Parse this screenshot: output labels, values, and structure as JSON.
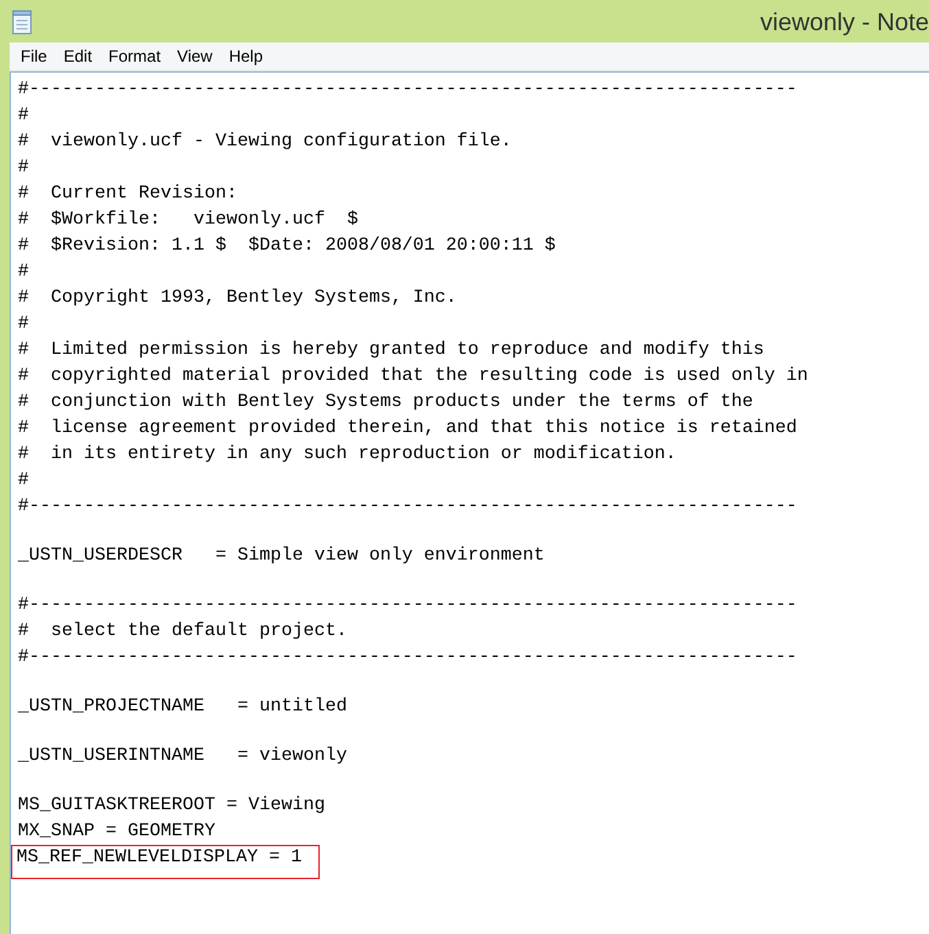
{
  "window": {
    "title": "viewonly - Note"
  },
  "menu": [
    "File",
    "Edit",
    "Format",
    "View",
    "Help"
  ],
  "lines": [
    {
      "kind": "text",
      "text": "#----------------------------------------------------------------------",
      "highlighted": false
    },
    {
      "kind": "text",
      "text": "#",
      "highlighted": false
    },
    {
      "kind": "text",
      "text": "#  viewonly.ucf - Viewing configuration file.",
      "highlighted": false
    },
    {
      "kind": "text",
      "text": "#",
      "highlighted": false
    },
    {
      "kind": "text",
      "text": "#  Current Revision:",
      "highlighted": false
    },
    {
      "kind": "text",
      "text": "#  $Workfile:   viewonly.ucf  $",
      "highlighted": false
    },
    {
      "kind": "text",
      "text": "#  $Revision: 1.1 $  $Date: 2008/08/01 20:00:11 $",
      "highlighted": false
    },
    {
      "kind": "text",
      "text": "#",
      "highlighted": false
    },
    {
      "kind": "text",
      "text": "#  Copyright 1993, Bentley Systems, Inc.",
      "highlighted": false
    },
    {
      "kind": "text",
      "text": "#",
      "highlighted": false
    },
    {
      "kind": "text",
      "text": "#  Limited permission is hereby granted to reproduce and modify this",
      "highlighted": false
    },
    {
      "kind": "text",
      "text": "#  copyrighted material provided that the resulting code is used only in",
      "highlighted": false
    },
    {
      "kind": "text",
      "text": "#  conjunction with Bentley Systems products under the terms of the",
      "highlighted": false
    },
    {
      "kind": "text",
      "text": "#  license agreement provided therein, and that this notice is retained",
      "highlighted": false
    },
    {
      "kind": "text",
      "text": "#  in its entirety in any such reproduction or modification.",
      "highlighted": false
    },
    {
      "kind": "text",
      "text": "#",
      "highlighted": false
    },
    {
      "kind": "text",
      "text": "#----------------------------------------------------------------------",
      "highlighted": false
    },
    {
      "kind": "blank"
    },
    {
      "kind": "text",
      "text": "_USTN_USERDESCR   = Simple view only environment",
      "highlighted": false
    },
    {
      "kind": "blank"
    },
    {
      "kind": "text",
      "text": "#----------------------------------------------------------------------",
      "highlighted": false
    },
    {
      "kind": "text",
      "text": "#  select the default project.",
      "highlighted": false
    },
    {
      "kind": "text",
      "text": "#----------------------------------------------------------------------",
      "highlighted": false
    },
    {
      "kind": "blank"
    },
    {
      "kind": "text",
      "text": "_USTN_PROJECTNAME   = untitled",
      "highlighted": false
    },
    {
      "kind": "blank"
    },
    {
      "kind": "text",
      "text": "_USTN_USERINTNAME   = viewonly",
      "highlighted": false
    },
    {
      "kind": "blank"
    },
    {
      "kind": "text",
      "text": "MS_GUITASKTREEROOT = Viewing",
      "highlighted": false
    },
    {
      "kind": "text",
      "text": "MX_SNAP = GEOMETRY",
      "highlighted": false
    },
    {
      "kind": "text",
      "text": "MS_REF_NEWLEVELDISPLAY = 1",
      "highlighted": true
    }
  ]
}
